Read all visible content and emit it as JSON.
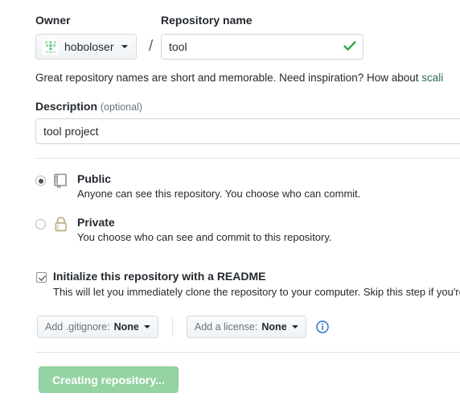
{
  "owner": {
    "label": "Owner",
    "name": "hoboloser",
    "avatar_icon": "identicon-avatar",
    "caret_icon": "chevron-down-icon"
  },
  "separator": "/",
  "repository": {
    "label": "Repository name",
    "value": "tool",
    "placeholder": "",
    "valid_icon": "check-icon"
  },
  "helper": {
    "text": "Great repository names are short and memorable. Need inspiration? How about ",
    "suggestion": "scali",
    "link_color": "#2f6f4e"
  },
  "description": {
    "label": "Description",
    "optional": "(optional)",
    "value": "tool project",
    "placeholder": ""
  },
  "visibility": {
    "public": {
      "title": "Public",
      "description": "Anyone can see this repository. You choose who can commit.",
      "icon": "repo-book-icon",
      "selected": true
    },
    "private": {
      "title": "Private",
      "description": "You choose who can see and commit to this repository.",
      "icon": "lock-icon",
      "selected": false
    }
  },
  "readme": {
    "title": "Initialize this repository with a README",
    "description": "This will let you immediately clone the repository to your computer. Skip this step if you're impo",
    "checked": true
  },
  "addons": {
    "gitignore_label": "Add .gitignore:",
    "gitignore_value": "None",
    "license_label": "Add a license:",
    "license_value": "None",
    "info_icon": "info-circle-icon"
  },
  "submit": {
    "label": "Creating repository...",
    "color": "#94d3a2",
    "disabled": true
  }
}
